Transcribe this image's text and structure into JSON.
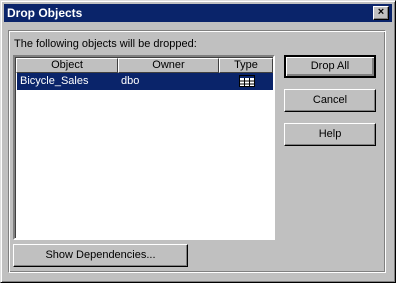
{
  "window": {
    "title": "Drop Objects",
    "close_glyph": "×"
  },
  "prompt": "The following objects will be dropped:",
  "table": {
    "columns": [
      "Object",
      "Owner",
      "Type"
    ],
    "rows": [
      {
        "object": "Bicycle_Sales",
        "owner": "dbo",
        "type_icon": "table-icon"
      }
    ]
  },
  "buttons": {
    "drop_all": "Drop All",
    "cancel": "Cancel",
    "help": "Help",
    "show_dependencies": "Show Dependencies..."
  },
  "colors": {
    "titlebar": "#0a246a",
    "selection": "#0a246a",
    "face": "#c0c0c0"
  }
}
